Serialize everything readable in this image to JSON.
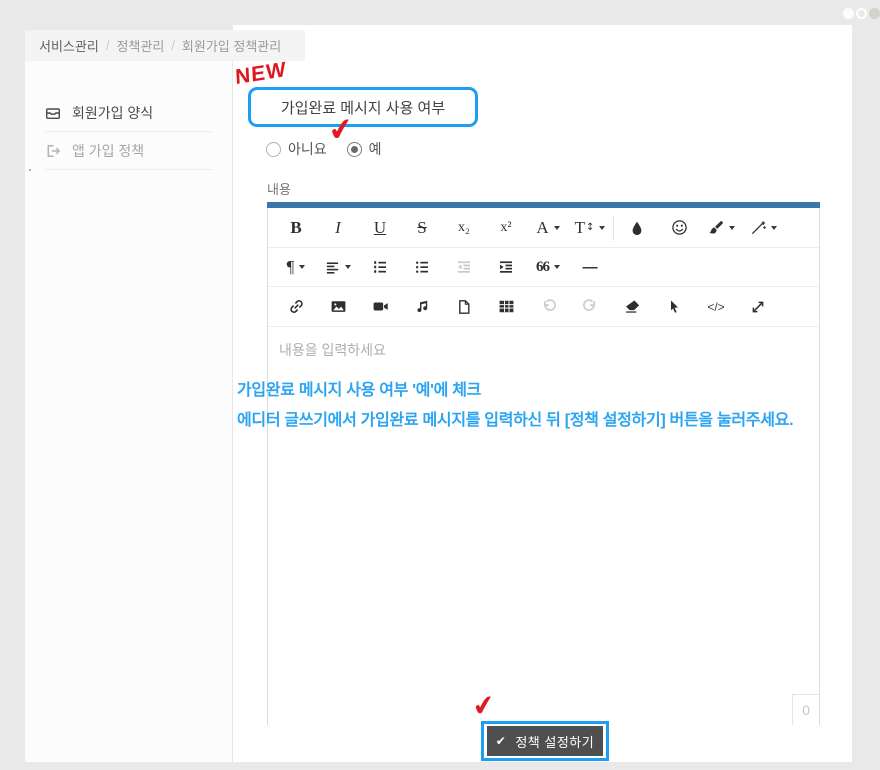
{
  "breadcrumb": {
    "items": [
      "서비스관리",
      "정책관리",
      "회원가입 정책관리"
    ],
    "separator": "/"
  },
  "sidebar": {
    "items": [
      {
        "icon": "inbox-icon",
        "label": "회원가입 양식"
      },
      {
        "icon": "sign-out-icon",
        "label": "앱 가입 정책"
      }
    ]
  },
  "main": {
    "new_badge": "NEW",
    "policy_title": "가입완료 메시지 사용 여부",
    "radio_no": "아니요",
    "radio_yes": "예",
    "content_label": "내용",
    "annotation_line1": "가입완료 메시지 사용 여부 '예'에 체크",
    "annotation_line2": "에디터 글쓰기에서 가입완료 메시지를 입력하신 뒤 [정책 설정하기] 버튼을 눌러주세요.",
    "submit_label": "정책 설정하기"
  },
  "editor": {
    "placeholder": "내용을 입력하세요",
    "char_count": "0",
    "toolbar": {
      "bold": "B",
      "italic": "I",
      "underline": "U",
      "strike": "S",
      "subscript": "x₂",
      "superscript": "x²",
      "font_color": "A",
      "line_height": "T",
      "paragraph": "¶",
      "quote": "66",
      "hr": "—",
      "code": "</>"
    }
  },
  "icons": {
    "check": "✔",
    "updown": "↕"
  },
  "colors": {
    "background": "#e9e9e9",
    "annotation_blue": "#1e9ef3",
    "annotation_text_blue": "#2ba4f2",
    "annotation_red": "#df1a22",
    "editor_topbar_blue": "#3a76ab",
    "submit_button_bg": "#4f4f4f"
  }
}
